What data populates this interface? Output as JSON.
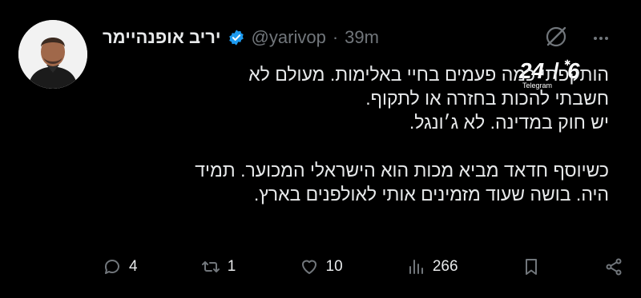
{
  "author": {
    "display_name": "יריב אופנהיימר",
    "handle": "@yarivop",
    "separator": "·",
    "time_ago": "39m"
  },
  "watermark": {
    "logo_text": "24/6",
    "sub_text": "Telegram"
  },
  "tweet": {
    "lines_block1": [
      "הותקפתי כמה פעמים בחיי באלימות. מעולם לא",
      "חשבתי להכות בחזרה או לתקוף.",
      "יש חוק במדינה. לא ג׳ונגל."
    ],
    "lines_block2": [
      "כשיוסף חדאד מביא מכות הוא הישראלי המכוער. תמיד",
      "היה. בושה שעוד מזמינים אותי לאולפנים בארץ."
    ]
  },
  "actions": {
    "replies": "4",
    "reposts": "1",
    "likes": "10",
    "views": "266"
  },
  "icons": [
    "verified-badge-icon",
    "grok-icon",
    "more-icon",
    "reply-icon",
    "repost-icon",
    "like-icon",
    "views-icon",
    "bookmark-icon",
    "share-icon"
  ],
  "colors": {
    "background": "#000000",
    "text": "#e7e9ea",
    "muted": "#71767b",
    "verified": "#1d9bf0"
  }
}
